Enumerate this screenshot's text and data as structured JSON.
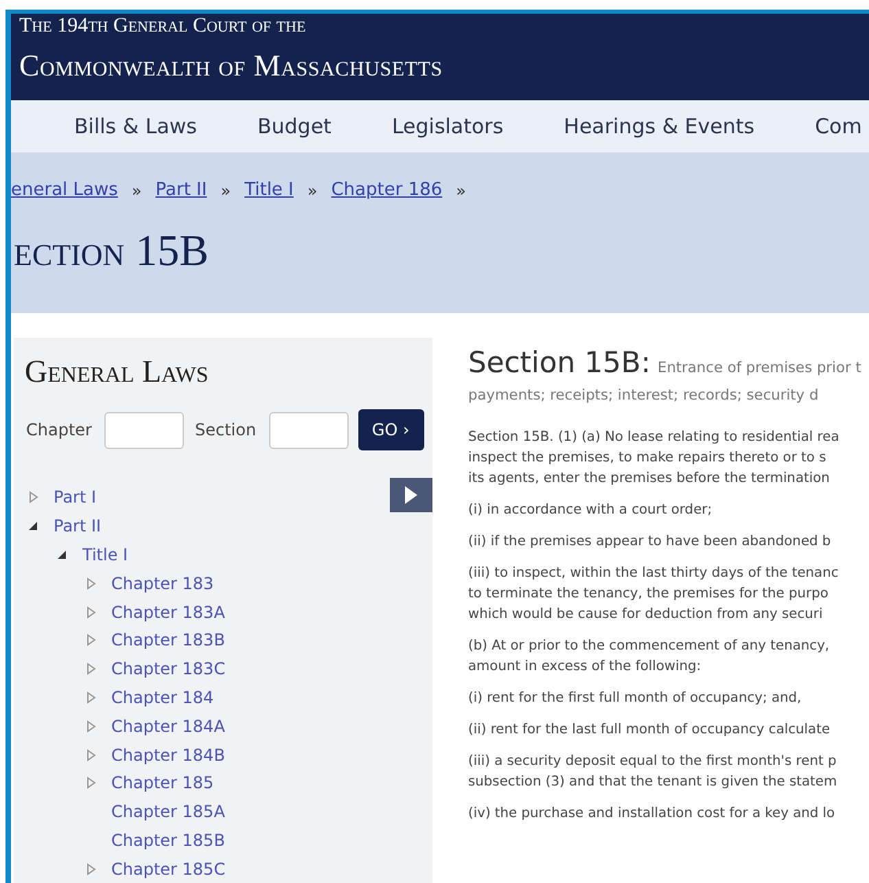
{
  "header": {
    "subtitle": "The 194th General Court of the",
    "title": "Commonwealth of Massachusetts"
  },
  "nav": [
    "Bills & Laws",
    "Budget",
    "Legislators",
    "Hearings & Events",
    "Com"
  ],
  "breadcrumbs": [
    {
      "label": "eneral Laws",
      "separator": "»"
    },
    {
      "label": "Part II",
      "separator": "»"
    },
    {
      "label": "Title I",
      "separator": "»"
    },
    {
      "label": "Chapter 186",
      "separator": "»"
    }
  ],
  "page_heading": "ection 15B",
  "sidebar": {
    "heading": "General Laws",
    "chapter_label": "Chapter",
    "section_label": "Section",
    "go_button": "GO ›",
    "tree": [
      {
        "label": "Part I",
        "expanded": false
      },
      {
        "label": "Part II",
        "expanded": true,
        "children": [
          {
            "label": "Title I",
            "expanded": true,
            "children": [
              {
                "label": "Chapter 183",
                "expanded": false
              },
              {
                "label": "Chapter 183A",
                "expanded": false
              },
              {
                "label": "Chapter 183B",
                "expanded": false
              },
              {
                "label": "Chapter 183C",
                "expanded": false
              },
              {
                "label": "Chapter 184",
                "expanded": false
              },
              {
                "label": "Chapter 184A",
                "expanded": false
              },
              {
                "label": "Chapter 184B",
                "expanded": false
              },
              {
                "label": "Chapter 185",
                "expanded": false
              },
              {
                "label": "Chapter 185A"
              },
              {
                "label": "Chapter 185B"
              },
              {
                "label": "Chapter 185C",
                "expanded": false
              }
            ]
          }
        ]
      }
    ]
  },
  "section": {
    "title": "Section 15B:",
    "subtitle_lines": [
      "Entrance of premises prior t",
      "payments; receipts; interest; records; security d"
    ],
    "paragraphs": [
      {
        "lines": [
          "Section 15B. (1) (a) No lease relating to residential rea",
          "inspect the premises, to make repairs thereto or to s",
          "its agents, enter the premises before the termination"
        ]
      },
      {
        "lines": [
          "(i) in accordance with a court order;"
        ]
      },
      {
        "lines": [
          "(ii) if the premises appear to have been abandoned b"
        ]
      },
      {
        "lines": [
          "(iii) to inspect, within the last thirty days of the tenanc",
          "to terminate the tenancy, the premises for the purpo",
          "which would be cause for deduction from any securi"
        ]
      },
      {
        "lines": [
          "(b) At or prior to the commencement of any tenancy,",
          "amount in excess of the following:"
        ]
      },
      {
        "lines": [
          "(i) rent for the first full month of occupancy; and,"
        ]
      },
      {
        "lines": [
          "(ii) rent for the last full month of occupancy calculate"
        ]
      },
      {
        "lines": [
          "(iii) a security deposit equal to the first month's rent p",
          "subsection (3) and that the tenant is given the statem"
        ]
      },
      {
        "lines": [
          "(iv) the purchase and installation cost for a key and lo"
        ]
      }
    ]
  }
}
